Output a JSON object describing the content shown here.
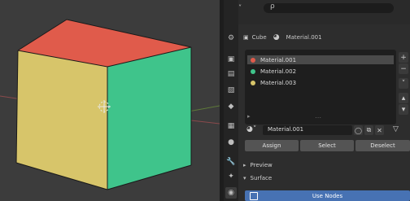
{
  "viewport": {
    "colors": {
      "background": "#3c3c3c",
      "top_face": "#e05b4b",
      "left_face": "#d7c56a",
      "right_face": "#3fc48b",
      "edges": "#1a1a1a",
      "axis_x": "#a0464b",
      "axis_y": "#7a9a3a"
    }
  },
  "header": {
    "editor_type_icon": "editor-type-icon",
    "search_placeholder": "ρ"
  },
  "breadcrumb": {
    "object_name": "Cube",
    "material_name": "Material.001"
  },
  "material_slots": [
    {
      "name": "Material.001",
      "color": "#e05b4b",
      "selected": true
    },
    {
      "name": "Material.002",
      "color": "#3fc48b",
      "selected": false
    },
    {
      "name": "Material.003",
      "color": "#d7c56a",
      "selected": false
    }
  ],
  "material_field": {
    "value": "Material.001"
  },
  "actions": {
    "assign": "Assign",
    "select": "Select",
    "deselect": "Deselect"
  },
  "sections": {
    "preview": "Preview",
    "surface": "Surface"
  },
  "use_nodes_label": "Use Nodes",
  "accent": "#4772b3"
}
